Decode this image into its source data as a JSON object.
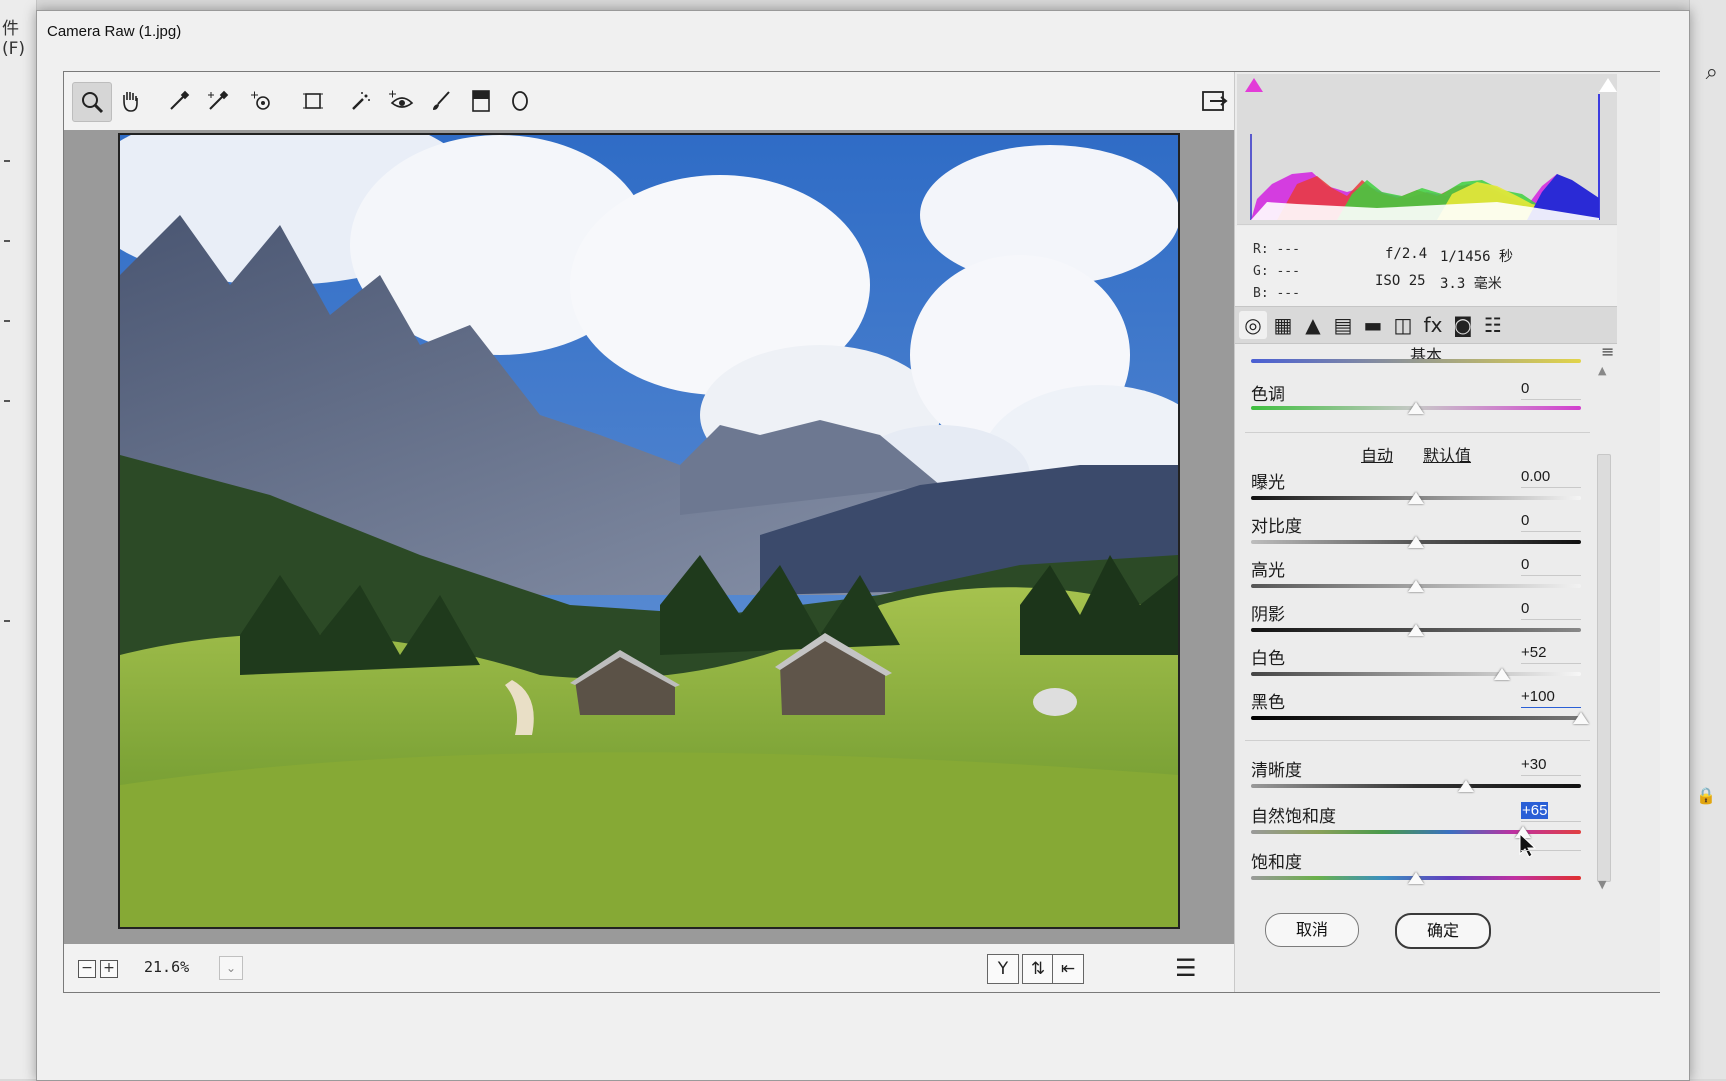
{
  "host": {
    "menu_fragment": "件(F)"
  },
  "window": {
    "title": "Camera Raw (1.jpg)"
  },
  "toolbar": {
    "tools": [
      {
        "name": "zoom-tool",
        "glyph": "🔍"
      },
      {
        "name": "hand-tool",
        "glyph": "✋"
      },
      {
        "name": "white-balance-tool",
        "glyph": "⁄"
      },
      {
        "name": "color-sampler-tool",
        "glyph": "✎"
      },
      {
        "name": "targeted-adjustment-tool",
        "glyph": "⊙"
      },
      {
        "name": "transform-tool",
        "glyph": "⌗"
      },
      {
        "name": "spot-removal-tool",
        "glyph": "✱"
      },
      {
        "name": "red-eye-tool",
        "glyph": "◉"
      },
      {
        "name": "adjustment-brush-tool",
        "glyph": "✏"
      },
      {
        "name": "graduated-filter-tool",
        "glyph": "▮"
      },
      {
        "name": "radial-filter-tool",
        "glyph": "○"
      }
    ],
    "export_glyph": "⇲"
  },
  "preview": {
    "zoom_minus": "−",
    "zoom_plus": "+",
    "zoom": "21.6%",
    "zoom_dropdown": "⌄",
    "view_mode_y": "Y",
    "swap_glyph": "⇅",
    "copy_glyph": "⇤",
    "settings_glyph": "☰"
  },
  "info": {
    "r_label": "R:",
    "r_value": "---",
    "g_label": "G:",
    "g_value": "---",
    "b_label": "B:",
    "b_value": "---",
    "aperture": "f/2.4",
    "shutter": "1/1456 秒",
    "iso": "ISO 25",
    "focal": "3.3 毫米"
  },
  "panel": {
    "section_title": "基本",
    "menu_glyph": "≡",
    "tabs": [
      "◎",
      "▦",
      "▲",
      "▤",
      "▬",
      "◫",
      "fx",
      "◙",
      "☷"
    ],
    "auto": "自动",
    "defaults": "默认值",
    "sliders": {
      "tint": {
        "label": "色调",
        "value": "0",
        "level": 0.5
      },
      "exposure": {
        "label": "曝光",
        "value": "0.00",
        "level": 0.5
      },
      "contrast": {
        "label": "对比度",
        "value": "0",
        "level": 0.5
      },
      "highlights": {
        "label": "高光",
        "value": "0",
        "level": 0.5
      },
      "shadows": {
        "label": "阴影",
        "value": "0",
        "level": 0.5
      },
      "whites": {
        "label": "白色",
        "value": "+52",
        "level": 0.76
      },
      "blacks": {
        "label": "黑色",
        "value": "+100",
        "level": 1.0
      },
      "clarity": {
        "label": "清晰度",
        "value": "+30",
        "level": 0.65
      },
      "vibrance": {
        "label": "自然饱和度",
        "value": "+65",
        "level": 0.825
      },
      "saturation": {
        "label": "饱和度",
        "value": "",
        "level": 0.5
      }
    }
  },
  "buttons": {
    "cancel": "取消",
    "ok": "确定"
  },
  "colors": {
    "selection": "#2a5fd6",
    "sky": "#3f78c8",
    "grass": "#8fb640",
    "mountain": "#5a6478"
  }
}
